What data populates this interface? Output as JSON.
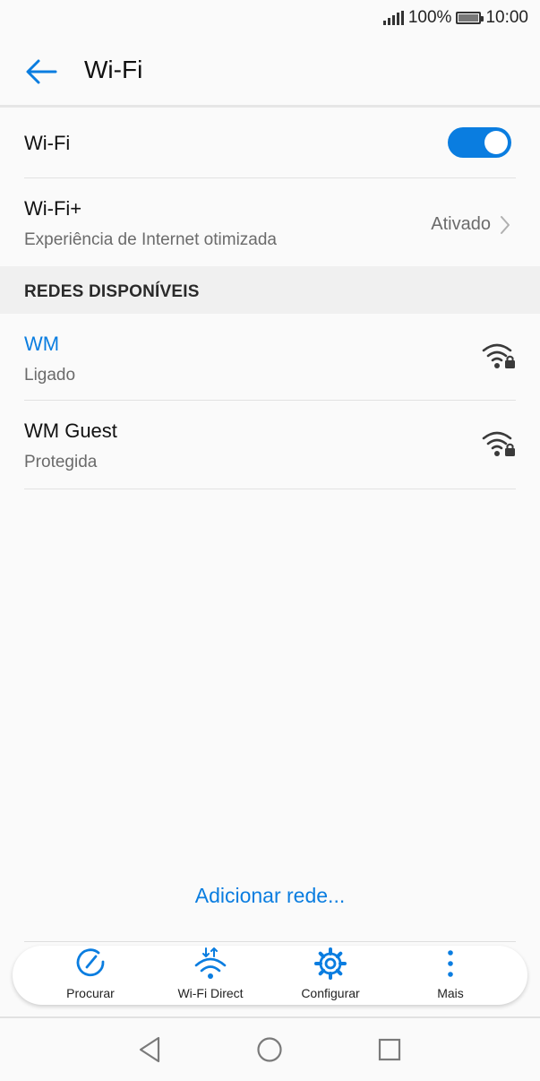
{
  "status_bar": {
    "battery_percent": "100%",
    "time": "10:00",
    "icons": [
      "signal-icon",
      "battery-icon"
    ]
  },
  "app_bar": {
    "title": "Wi-Fi",
    "back_icon": "arrow-left-icon"
  },
  "wifi_toggle": {
    "label": "Wi-Fi",
    "on": true
  },
  "wifi_plus": {
    "label": "Wi-Fi+",
    "subtitle": "Experiência de Internet otimizada",
    "value": "Ativado"
  },
  "section": {
    "title": "REDES DISPONÍVEIS"
  },
  "networks": [
    {
      "name": "WM",
      "status": "Ligado",
      "connected": true,
      "icon": "wifi-lock-icon"
    },
    {
      "name": "WM Guest",
      "status": "Protegida",
      "connected": false,
      "icon": "wifi-lock-icon"
    }
  ],
  "add_network": "Adicionar rede...",
  "toolbar": [
    {
      "label": "Procurar",
      "icon": "refresh-icon"
    },
    {
      "label": "Wi-Fi Direct",
      "icon": "wifi-direct-icon"
    },
    {
      "label": "Configurar",
      "icon": "gear-icon"
    },
    {
      "label": "Mais",
      "icon": "more-vertical-icon"
    }
  ],
  "nav_bar": {
    "icons": [
      "back-triangle-icon",
      "home-circle-icon",
      "recents-square-icon"
    ]
  },
  "colors": {
    "accent": "#0a7de0",
    "background": "#fafafa",
    "section_bg": "#f0f0f0",
    "secondary_text": "#6b6b6b"
  }
}
